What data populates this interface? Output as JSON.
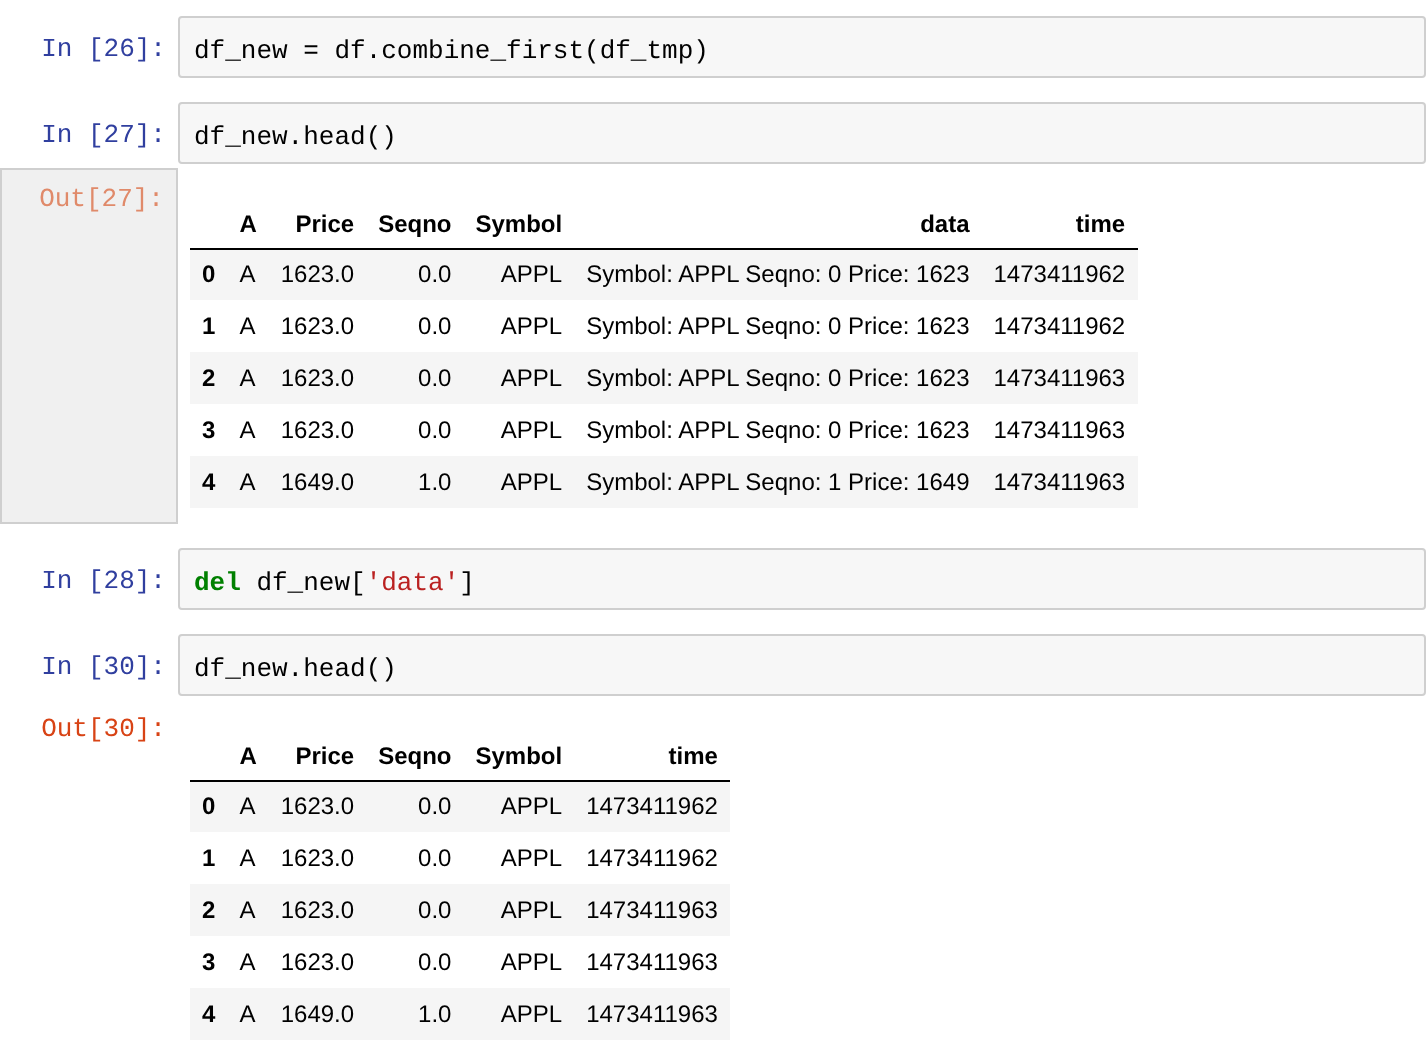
{
  "cells": [
    {
      "prompt": "In [26]:",
      "code": [
        {
          "kind": "plain",
          "text": "df_new = df.combine_first(df_tmp)"
        }
      ]
    },
    {
      "prompt": "In [27]:",
      "code": [
        {
          "kind": "plain",
          "text": "df_new.head()"
        }
      ],
      "output": {
        "prompt": "Out[27]:",
        "highlighted": true,
        "columns": [
          "",
          "A",
          "Price",
          "Seqno",
          "Symbol",
          "data",
          "time"
        ],
        "rows": [
          [
            "0",
            "A",
            "1623.0",
            "0.0",
            "APPL",
            "Symbol: APPL Seqno: 0 Price: 1623",
            "1473411962"
          ],
          [
            "1",
            "A",
            "1623.0",
            "0.0",
            "APPL",
            "Symbol: APPL Seqno: 0 Price: 1623",
            "1473411962"
          ],
          [
            "2",
            "A",
            "1623.0",
            "0.0",
            "APPL",
            "Symbol: APPL Seqno: 0 Price: 1623",
            "1473411963"
          ],
          [
            "3",
            "A",
            "1623.0",
            "0.0",
            "APPL",
            "Symbol: APPL Seqno: 0 Price: 1623",
            "1473411963"
          ],
          [
            "4",
            "A",
            "1649.0",
            "1.0",
            "APPL",
            "Symbol: APPL Seqno: 1 Price: 1649",
            "1473411963"
          ]
        ]
      }
    },
    {
      "prompt": "In [28]:",
      "code": [
        {
          "kind": "keyword",
          "text": "del"
        },
        {
          "kind": "plain",
          "text": " df_new["
        },
        {
          "kind": "string",
          "text": "'data'"
        },
        {
          "kind": "plain",
          "text": "]"
        }
      ]
    },
    {
      "prompt": "In [30]:",
      "code": [
        {
          "kind": "plain",
          "text": "df_new.head()"
        }
      ],
      "output": {
        "prompt": "Out[30]:",
        "highlighted": false,
        "columns": [
          "",
          "A",
          "Price",
          "Seqno",
          "Symbol",
          "time"
        ],
        "rows": [
          [
            "0",
            "A",
            "1623.0",
            "0.0",
            "APPL",
            "1473411962"
          ],
          [
            "1",
            "A",
            "1623.0",
            "0.0",
            "APPL",
            "1473411962"
          ],
          [
            "2",
            "A",
            "1623.0",
            "0.0",
            "APPL",
            "1473411963"
          ],
          [
            "3",
            "A",
            "1623.0",
            "0.0",
            "APPL",
            "1473411963"
          ],
          [
            "4",
            "A",
            "1649.0",
            "1.0",
            "APPL",
            "1473411963"
          ]
        ]
      }
    }
  ]
}
